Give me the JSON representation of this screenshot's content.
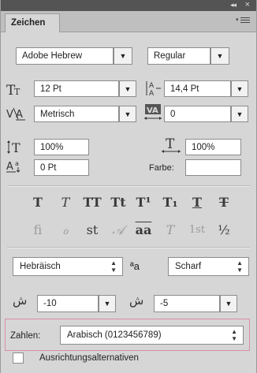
{
  "panel": {
    "tab_label": "Zeichen",
    "collapse_glyph": "◂◂",
    "close_glyph": "×"
  },
  "font": {
    "family": "Adobe Hebrew",
    "style": "Regular"
  },
  "metrics": {
    "size": "12 Pt",
    "leading": "14,4 Pt",
    "kerning": "Metrisch",
    "tracking": "0",
    "vertical_scale": "100%",
    "horizontal_scale": "100%",
    "baseline_shift": "0 Pt",
    "color_label": "Farbe:"
  },
  "glyph_labels": {
    "size_icon": "TT",
    "leading_icon": "A/A",
    "kerning_icon": "V/A",
    "tracking_icon": "VA",
    "vscale_icon": "IT",
    "hscale_icon": "T",
    "baseline_icon": "Aª"
  },
  "style_buttons": [
    "T",
    "T",
    "TT",
    "Tt",
    "T¹",
    "T₁",
    "T",
    "T"
  ],
  "opentype_buttons": [
    "fi",
    "ℴ",
    "st",
    "𝒜",
    "aa",
    "T",
    "1st",
    "½"
  ],
  "language": {
    "value": "Hebräisch",
    "aa_label": "ªa",
    "antialias": "Scharf"
  },
  "arabic": {
    "kashida_value": "-10",
    "diacritic_value": "-5"
  },
  "numbers": {
    "label": "Zahlen:",
    "value": "Arabisch (0123456789)"
  },
  "alternates": {
    "label": "Ausrichtungsalternativen"
  }
}
